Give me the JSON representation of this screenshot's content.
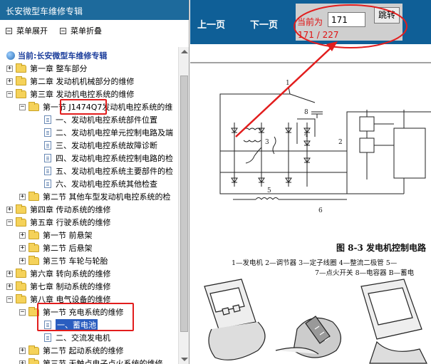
{
  "sidebar": {
    "title": "长安微型车维修专辑",
    "expand_all": "菜单展开",
    "collapse_all": "菜单折叠",
    "current": "当前:长安微型车维修专辑",
    "items": [
      {
        "label": "第一章 整车部分"
      },
      {
        "label": "第二章 发动机机械部分的维修"
      },
      {
        "label": "第三章 发动机电控系统的维修"
      },
      {
        "label": "第一节 J1474Q7发动机电控系统的维"
      },
      {
        "label": "一、发动机电控系统部件位置"
      },
      {
        "label": "二、发动机电控单元控制电路及端"
      },
      {
        "label": "三、发动机电控系统故障诊断"
      },
      {
        "label": "四、发动机电控系统控制电路的检"
      },
      {
        "label": "五、发动机电控系统主要部件的检"
      },
      {
        "label": "六、发动机电控系统其他检查"
      },
      {
        "label": "第二节 其他车型发动机电控系统的检"
      },
      {
        "label": "第四章 传动系统的维修"
      },
      {
        "label": "第五章 行驶系统的维修"
      },
      {
        "label": "第一节 前悬架"
      },
      {
        "label": "第二节 后悬架"
      },
      {
        "label": "第三节 车轮与轮胎"
      },
      {
        "label": "第六章 转向系统的维修"
      },
      {
        "label": "第七章 制动系统的维修"
      },
      {
        "label": "第八章 电气设备的维修"
      },
      {
        "label": "第一节 充电系统的维修"
      },
      {
        "label": "一、蓄电池"
      },
      {
        "label": "二、交流发电机"
      },
      {
        "label": "第二节 起动系统的维修"
      },
      {
        "label": "第三节 无触点电子点火系统的维修"
      }
    ]
  },
  "toolbar": {
    "prev": "上一页",
    "next": "下一页",
    "current_label": "当前为",
    "page_count": "171 / 227",
    "page_input": "171",
    "jump": "跳转"
  },
  "figure": {
    "labels": [
      "1",
      "8",
      "3",
      "4",
      "2",
      "5",
      "6"
    ],
    "caption": "图 8-3   发电机控制电路",
    "legend1": "1—发电机   2—调节器   3—定子线圈   4—整流二极管   5—",
    "legend2": "7—点火开关   8—电容器   B—蓄电"
  }
}
